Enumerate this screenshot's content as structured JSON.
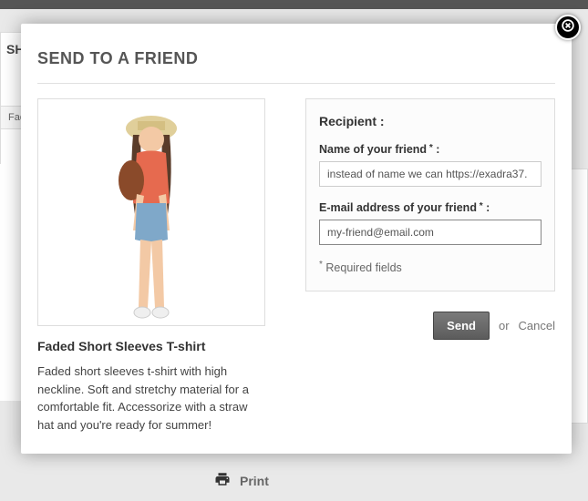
{
  "background": {
    "snippet": "SH",
    "crumb": "Fade",
    "print": "Print"
  },
  "modal": {
    "title": "SEND TO A FRIEND",
    "form": {
      "recipient_heading": "Recipient :",
      "name_label": "Name of your friend",
      "name_value": "instead of name we can https://exadra37.",
      "email_label": "E-mail address of your friend",
      "email_value": "my-friend@email.com",
      "required_note": "Required fields"
    },
    "product": {
      "title": "Faded Short Sleeves T-shirt",
      "description": "Faded short sleeves t-shirt with high neckline. Soft and stretchy material for a comfortable fit. Accessorize with a straw hat and you're ready for summer!"
    },
    "actions": {
      "send": "Send",
      "or": "or",
      "cancel": "Cancel"
    }
  }
}
